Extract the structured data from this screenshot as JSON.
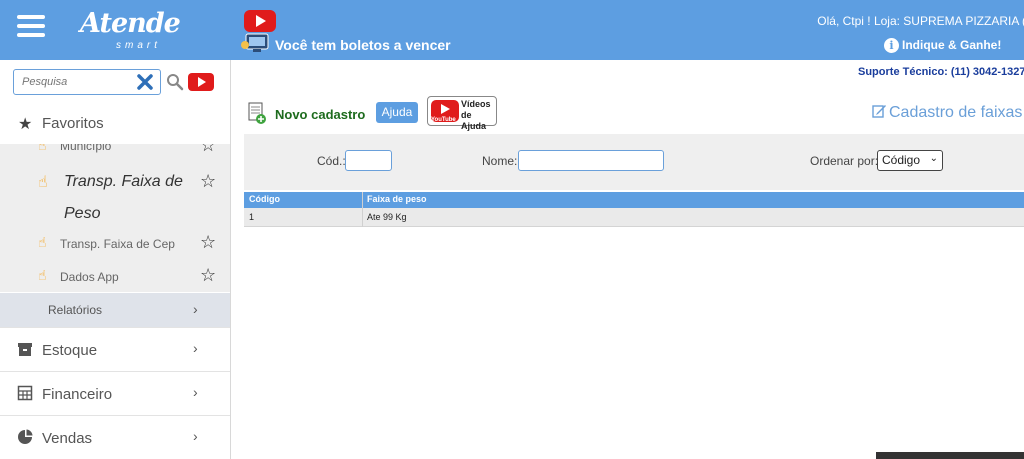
{
  "header": {
    "logo_text": "Atende",
    "logo_sub": "smart",
    "boletos_text": "Você tem boletos a vencer",
    "greeting": "Olá, Ctpi ! Loja: SUPREMA PIZZARIA (",
    "indique": "Indique & Ganhe!",
    "suporte": "Suporte Técnico: (11) 3042-1327 /"
  },
  "sidebar": {
    "search_placeholder": "Pesquisa",
    "favorites_label": "Favoritos",
    "favorites": [
      {
        "label": "Município"
      },
      {
        "label": "Transp. Faixa de Peso"
      },
      {
        "label": "Transp. Faixa de Cep"
      },
      {
        "label": "Dados App"
      }
    ],
    "relatorios_label": "Relatórios",
    "menu": [
      {
        "label": "Estoque",
        "icon": "box-icon"
      },
      {
        "label": "Financeiro",
        "icon": "calculator-icon"
      },
      {
        "label": "Vendas",
        "icon": "pie-chart-icon"
      }
    ]
  },
  "toolbar": {
    "novo_label": "Novo cadastro",
    "ajuda_label": "Ajuda",
    "videos_label_1": "Vídeos",
    "videos_label_2": "de Ajuda",
    "youtube_word": "YouTube",
    "page_title": "Cadastro de faixas"
  },
  "filters": {
    "cod_label": "Cód.:",
    "nome_label": "Nome:",
    "ordenar_label": "Ordenar por:",
    "ordenar_value": "Código"
  },
  "table": {
    "columns": [
      "Código",
      "Faixa de peso"
    ],
    "rows": [
      [
        "1",
        "Ate 99 Kg"
      ]
    ]
  },
  "colors": {
    "header_bg": "#5d9ee1",
    "novo_green": "#1d6b1d",
    "youtube_red": "#e01b1b"
  }
}
